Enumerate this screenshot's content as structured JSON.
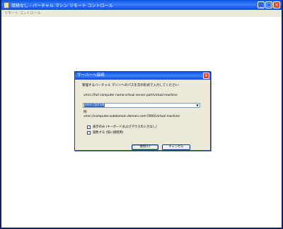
{
  "window": {
    "title": "接続なし - バーチャル マシン リモート コントロール",
    "minimize_glyph": "_",
    "maximize_glyph": "□",
    "close_glyph": "×"
  },
  "menu": {
    "items": [
      "リモート コントロール"
    ]
  },
  "dialog": {
    "title": "サーバーへ接続",
    "close_glyph": "×",
    "instruction": "管理するバーチャル マシンへのパスを次の形式で入力してください:",
    "format": "vmrc://full computer name:virtual server port/virtual machine",
    "address_value": "vmrc://jkt:b8",
    "dropdown_glyph": "▼",
    "example_label": "例:",
    "example": "vmrc://computer.subdomain.domain.com:5900/virtual machine",
    "checkbox_view_only": "表示のみ (キーボードおよびマウスの入力なし)",
    "checkbox_reduce_colors": "減色する (低い接続用)",
    "connect_button": "接続(C)",
    "cancel_button": "キャンセル"
  }
}
